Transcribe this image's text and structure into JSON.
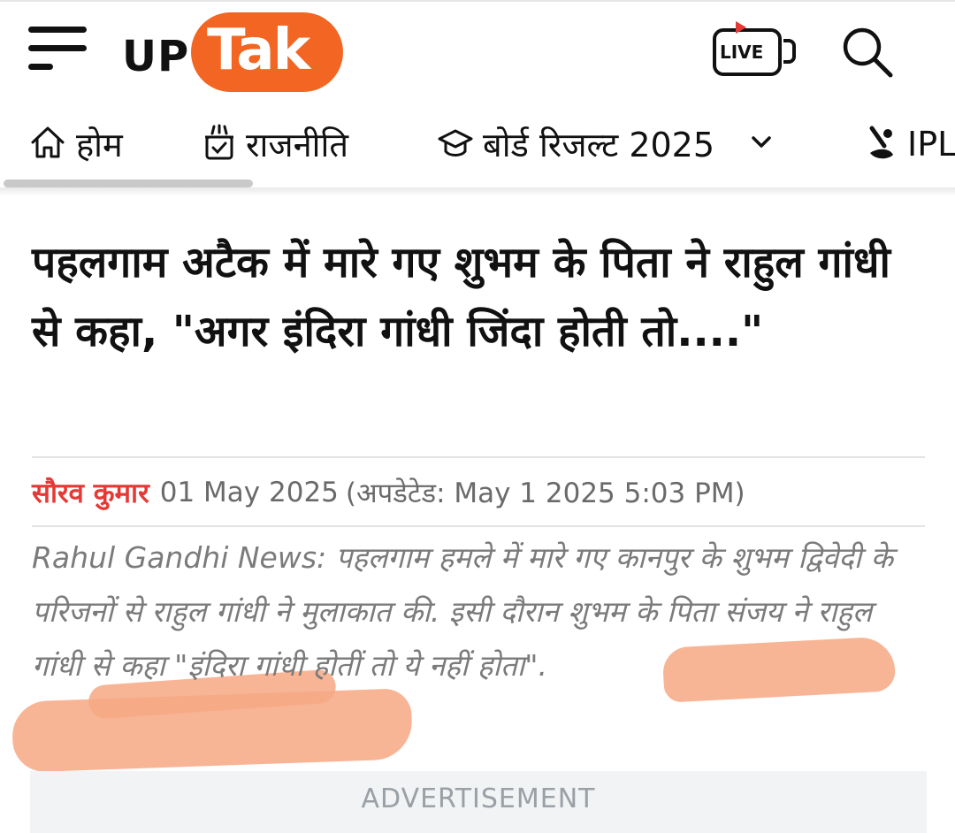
{
  "header": {
    "logo_part1": "UP",
    "logo_part2": "Tak",
    "live_label": "LIVE"
  },
  "nav": {
    "items": [
      {
        "label": "होम",
        "icon": "home-icon"
      },
      {
        "label": "राजनीति",
        "icon": "politics-icon"
      },
      {
        "label": "बोर्ड रिजल्ट 2025",
        "icon": "graduation-cap-icon"
      },
      {
        "label": "IPL",
        "icon": "cricket-icon"
      }
    ]
  },
  "article": {
    "headline": "पहलगाम अटैक में मारे गए शुभम के पिता ने राहुल गांधी से कहा, \"अगर इंदिरा गांधी जिंदा होती तो....\"",
    "author": "सौरव कुमार",
    "date": "01 May 2025",
    "updated": "(अपडेटेड: May 1 2025 5:03 PM)",
    "summary": "Rahul Gandhi News: पहलगाम हमले में मारे गए कानपुर के शुभम द्विवेदी के परिजनों से राहुल गांधी ने मुलाकात की. इसी दौरान शुभम के पिता संजय ने राहुल गांधी से कहा \"इंदिरा गांधी होतीं तो ये नहीं होता\"."
  },
  "ad": {
    "label": "ADVERTISEMENT"
  },
  "colors": {
    "brand": "#f26522",
    "author": "#e53935",
    "highlight": "#f6a884"
  }
}
